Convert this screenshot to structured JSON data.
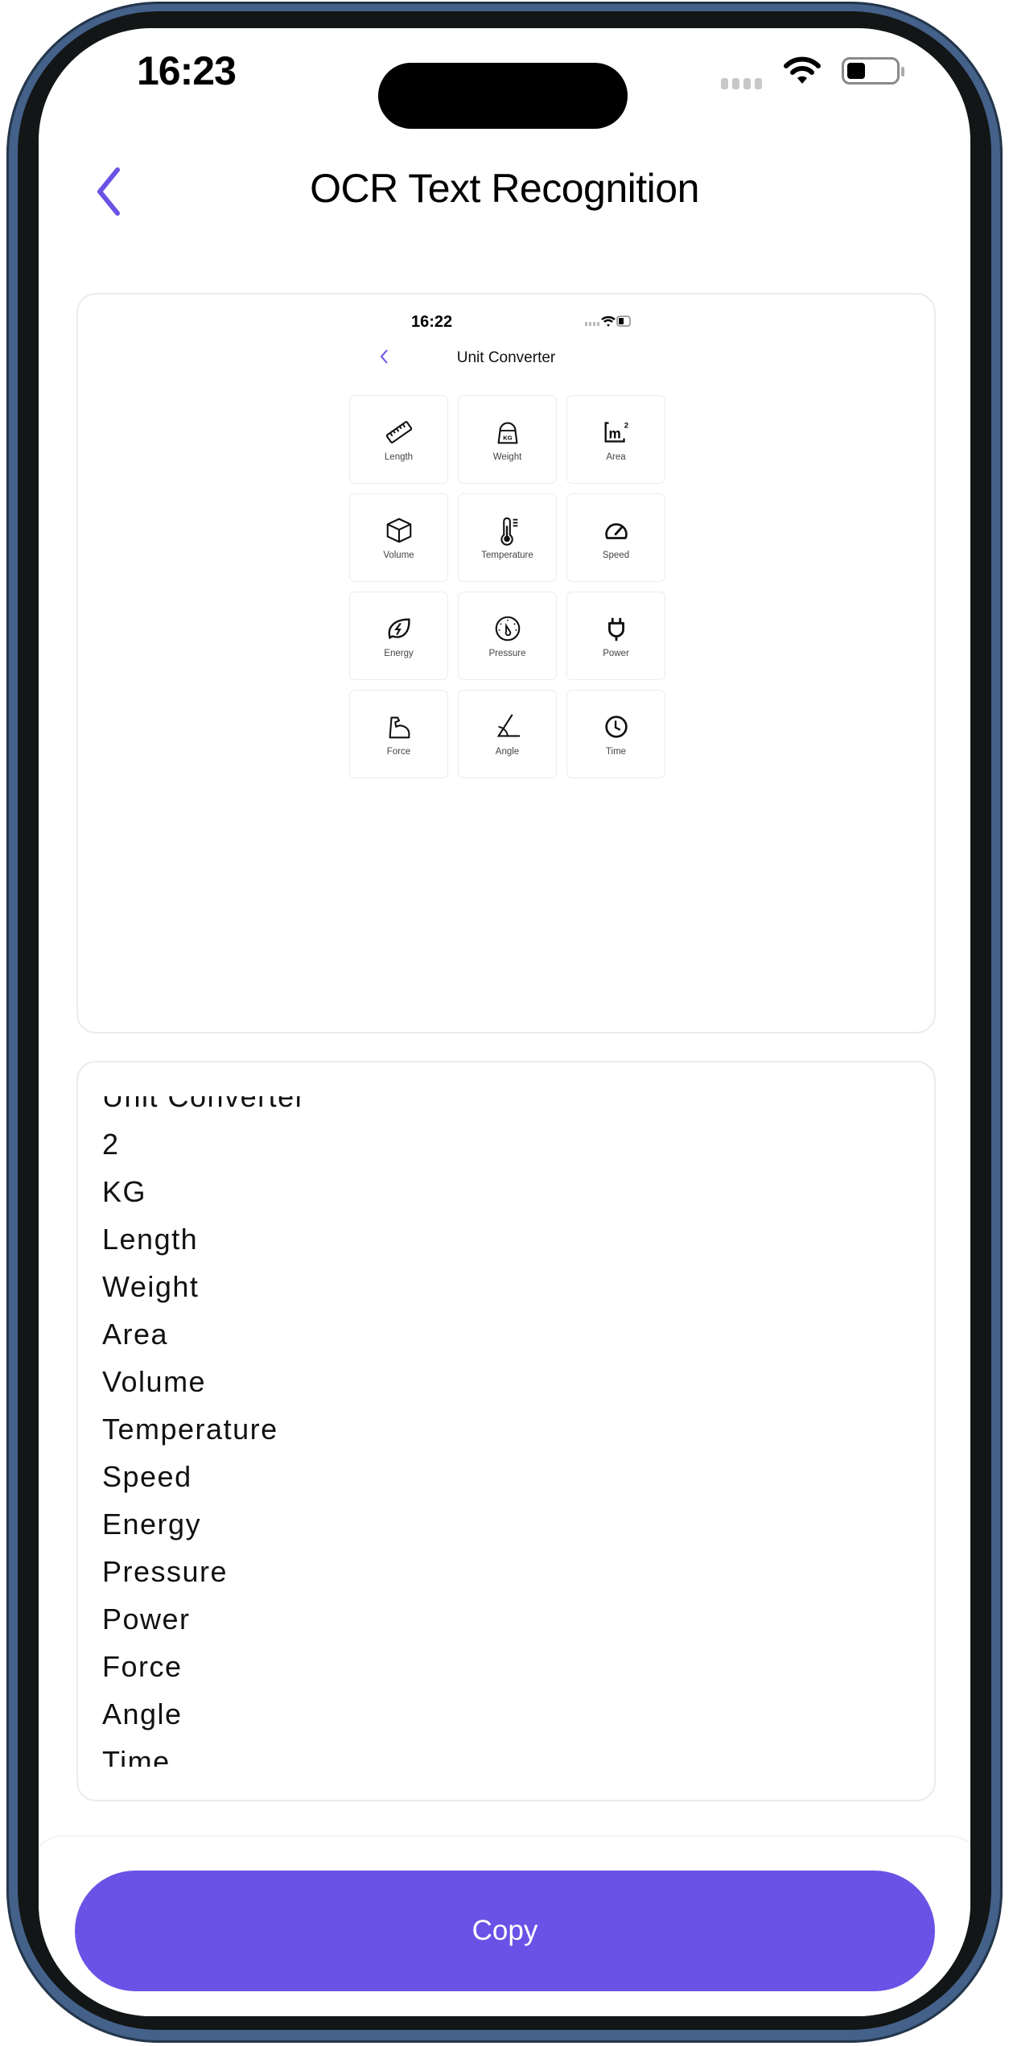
{
  "status_bar": {
    "time": "16:23",
    "icons": [
      "cellular-dots-icon",
      "wifi-icon",
      "battery-icon"
    ]
  },
  "header": {
    "title": "OCR Text Recognition",
    "back_icon": "chevron-left-icon"
  },
  "colors": {
    "accent": "#6a52e6",
    "frame": "#44618a"
  },
  "image_preview": {
    "status_time": "16:22",
    "title": "Unit Converter",
    "tiles": [
      {
        "label": "Length",
        "icon": "ruler-icon"
      },
      {
        "label": "Weight",
        "icon": "kg-weight-icon"
      },
      {
        "label": "Area",
        "icon": "square-meter-icon"
      },
      {
        "label": "Volume",
        "icon": "cube-icon"
      },
      {
        "label": "Temperature",
        "icon": "thermometer-icon"
      },
      {
        "label": "Speed",
        "icon": "speedometer-icon"
      },
      {
        "label": "Energy",
        "icon": "leaf-bolt-icon"
      },
      {
        "label": "Pressure",
        "icon": "pressure-gauge-icon"
      },
      {
        "label": "Power",
        "icon": "plug-icon"
      },
      {
        "label": "Force",
        "icon": "flexed-arm-icon"
      },
      {
        "label": "Angle",
        "icon": "angle-icon"
      },
      {
        "label": "Time",
        "icon": "clock-icon"
      }
    ]
  },
  "recognized_text": {
    "lines": [
      "Unit Converter",
      "2",
      "KG",
      "Length",
      "Weight",
      "Area",
      "Volume",
      "Temperature",
      "Speed",
      "Energy",
      "Pressure",
      "Power",
      "Force",
      "Angle",
      "Time"
    ]
  },
  "actions": {
    "copy_label": "Copy"
  }
}
